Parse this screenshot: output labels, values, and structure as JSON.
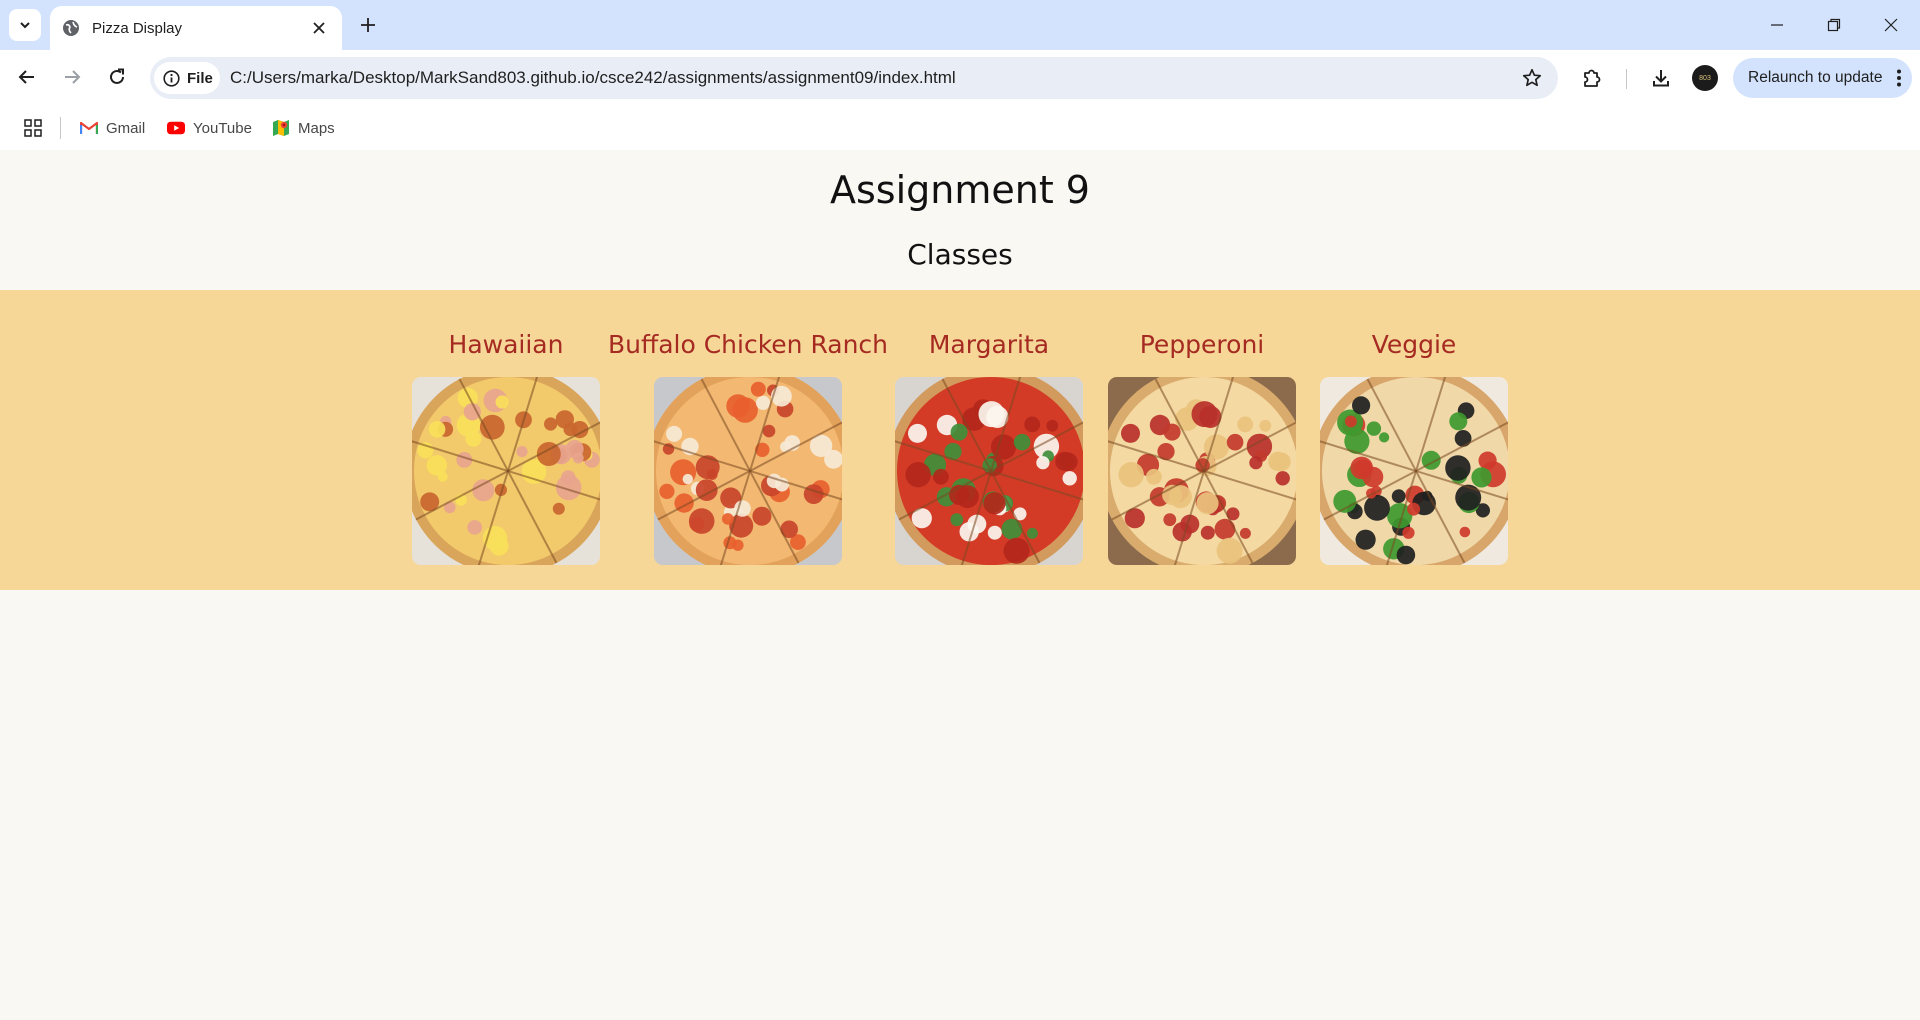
{
  "browser": {
    "tab_title": "Pizza Display",
    "site_chip_label": "File",
    "url": "C:/Users/marka/Desktop/MarkSand803.github.io/csce242/assignments/assignment09/index.html",
    "relaunch_label": "Relaunch to update",
    "profile_initials": "803"
  },
  "bookmarks": [
    {
      "label": "Gmail",
      "icon": "gmail-icon"
    },
    {
      "label": "YouTube",
      "icon": "youtube-icon"
    },
    {
      "label": "Maps",
      "icon": "maps-icon"
    }
  ],
  "page": {
    "title": "Assignment 9",
    "subtitle": "Classes"
  },
  "pizzas": [
    {
      "name": "Hawaiian",
      "crust": "#d9a55a",
      "cheese": "#f2c96b",
      "toppings": [
        "#f8e05a",
        "#e8a48e",
        "#c9662f"
      ],
      "bg": "#e7e2d9"
    },
    {
      "name": "Buffalo Chicken Ranch",
      "crust": "#e3a25b",
      "cheese": "#f3b872",
      "toppings": [
        "#e8602e",
        "#f6e9d6",
        "#c9442a"
      ],
      "bg": "#c7c8cc"
    },
    {
      "name": "Margarita",
      "crust": "#d29a5c",
      "cheese": "#d33b27",
      "toppings": [
        "#fbf6ee",
        "#3f8f3a",
        "#b3271b"
      ],
      "bg": "#d8d4cf"
    },
    {
      "name": "Pepperoni",
      "crust": "#d9ab6d",
      "cheese": "#f4d9a2",
      "toppings": [
        "#b8302a",
        "#c23a2c",
        "#e9c27d"
      ],
      "bg": "#8b6b4c"
    },
    {
      "name": "Veggie",
      "crust": "#d8a66a",
      "cheese": "#f0d8a8",
      "toppings": [
        "#cf3a2b",
        "#3e9a2f",
        "#1f1f1f"
      ],
      "bg": "#efe9df"
    }
  ]
}
